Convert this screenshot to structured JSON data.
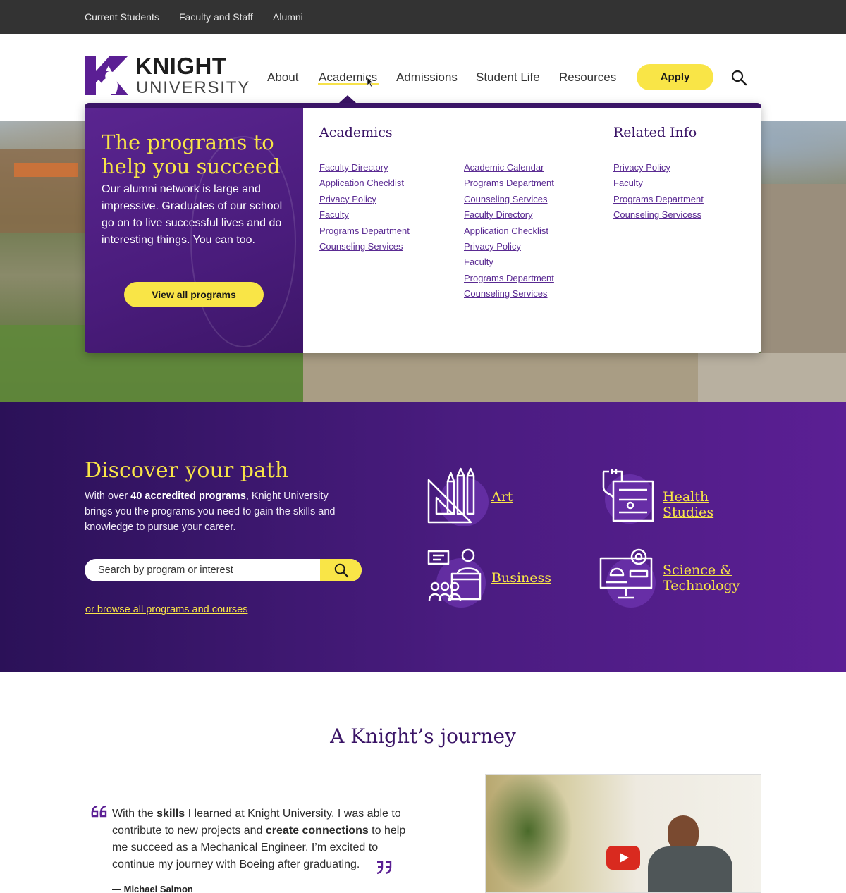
{
  "utility_nav": [
    "Current Students",
    "Faculty and Staff",
    "Alumni"
  ],
  "logo": {
    "line1": "KNIGHT",
    "line2": "UNIVERSITY"
  },
  "main_nav": [
    "About",
    "Academics",
    "Admissions",
    "Student Life",
    "Resources"
  ],
  "apply_label": "Apply",
  "mega_menu": {
    "heading": "The programs to help you succeed",
    "text": "Our alumni network is large and impressive. Graduates of our school go on to live successful lives and do interesting things. You can too.",
    "cta": "View all programs",
    "academics_title": "Academics",
    "academics_col1": [
      "Faculty Directory",
      "Application Checklist",
      "Privacy Policy",
      "Faculty",
      "Programs Department",
      "Counseling Services"
    ],
    "academics_col2": [
      "Academic Calendar",
      "Programs Department",
      "Counseling Services",
      "Faculty Directory",
      "Application Checklist",
      "Privacy Policy",
      "Faculty",
      "Programs Department",
      "Counseling Services"
    ],
    "related_title": "Related Info",
    "related_links": [
      "Privacy Policy",
      "Faculty",
      "Programs Department",
      "Counseling Servicess"
    ]
  },
  "discover": {
    "title": "Discover your path",
    "text_pre": "With over ",
    "text_bold": "40 accredited programs",
    "text_post": ", Knight University brings you the programs you need to gain the skills and knowledge to pursue your career.",
    "search_placeholder": "Search by program or interest",
    "browse_link": "or browse all programs and courses",
    "categories": {
      "art": "Art",
      "health": "Health Studies",
      "business": "Business",
      "science_line1": "Science &",
      "science_line2": "Technology"
    }
  },
  "journey": {
    "title": "A Knight’s journey",
    "quote": [
      {
        "text": "With the ",
        "bold": false
      },
      {
        "text": "skills",
        "bold": true
      },
      {
        "text": " I learned at Knight University, I was able to contribute to new projects and ",
        "bold": false
      },
      {
        "text": "create connections",
        "bold": true
      },
      {
        "text": " to help me succeed as a Mechanical Engineer. I’m excited to continue my journey with Boeing after graduating.",
        "bold": false
      }
    ],
    "author": "— Michael Salmon"
  },
  "colors": {
    "brand_purple": "#4a1c7c",
    "accent_yellow": "#f9e547",
    "utility_bar": "#333333"
  },
  "icons": [
    "search-icon",
    "quote-open-icon",
    "quote-close-icon",
    "play-icon",
    "art-icon",
    "health-icon",
    "business-icon",
    "science-icon"
  ]
}
